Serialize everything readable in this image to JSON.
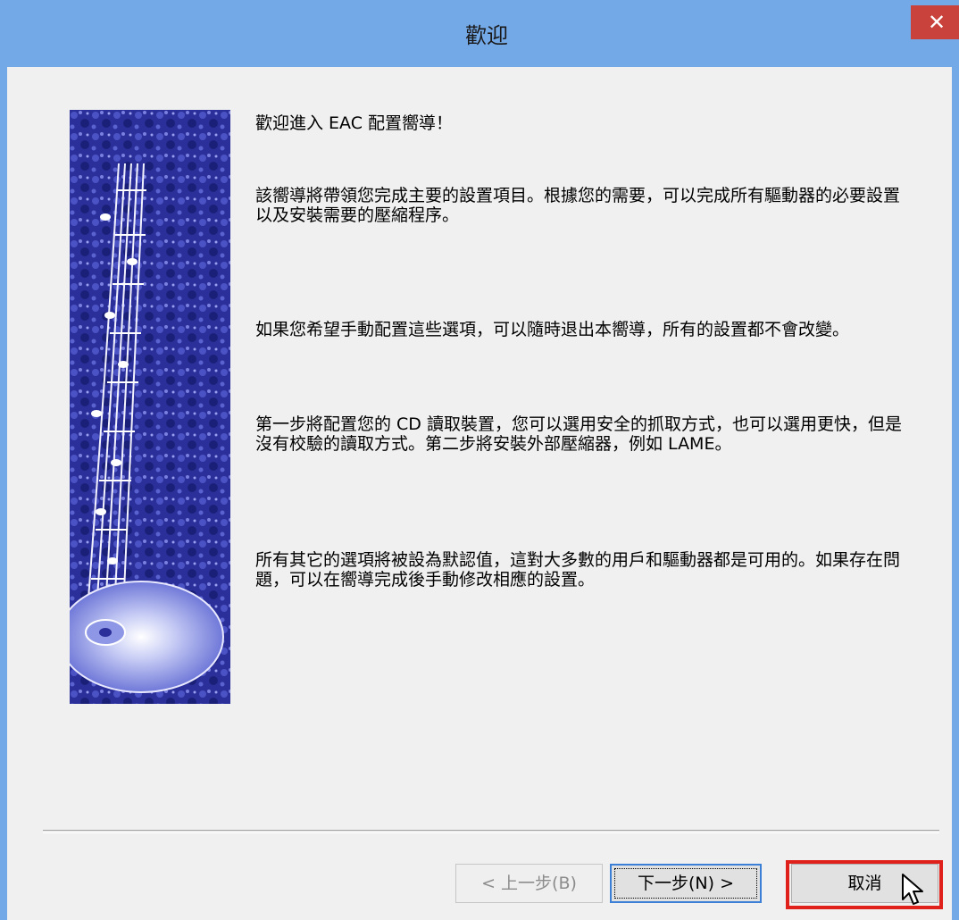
{
  "window": {
    "title": "歡迎",
    "close_glyph": "✕"
  },
  "content": {
    "heading": "歡迎進入 EAC 配置嚮導！",
    "para1": "該嚮導將帶領您完成主要的設置項目。根據您的需要，可以完成所有驅動器的必要設置以及安裝需要的壓縮程序。",
    "para2": "如果您希望手動配置這些選項，可以隨時退出本嚮導，所有的設置都不會改變。",
    "para3": "第一步將配置您的 CD 讀取裝置，您可以選用安全的抓取方式，也可以選用更快，但是沒有校驗的讀取方式。第二步將安裝外部壓縮器，例如 LAME。",
    "para4": "所有其它的選項將被設為默認值，這對大多數的用戶和驅動器都是可用的。如果存在問題，可以在嚮導完成後手動修改相應的設置。"
  },
  "buttons": {
    "back": "< 上一步(B)",
    "next": "下一步(N) >",
    "cancel": "取消"
  },
  "colors": {
    "titlebar": "#74a9e8",
    "close": "#c9433c",
    "highlight": "#e0201b"
  }
}
